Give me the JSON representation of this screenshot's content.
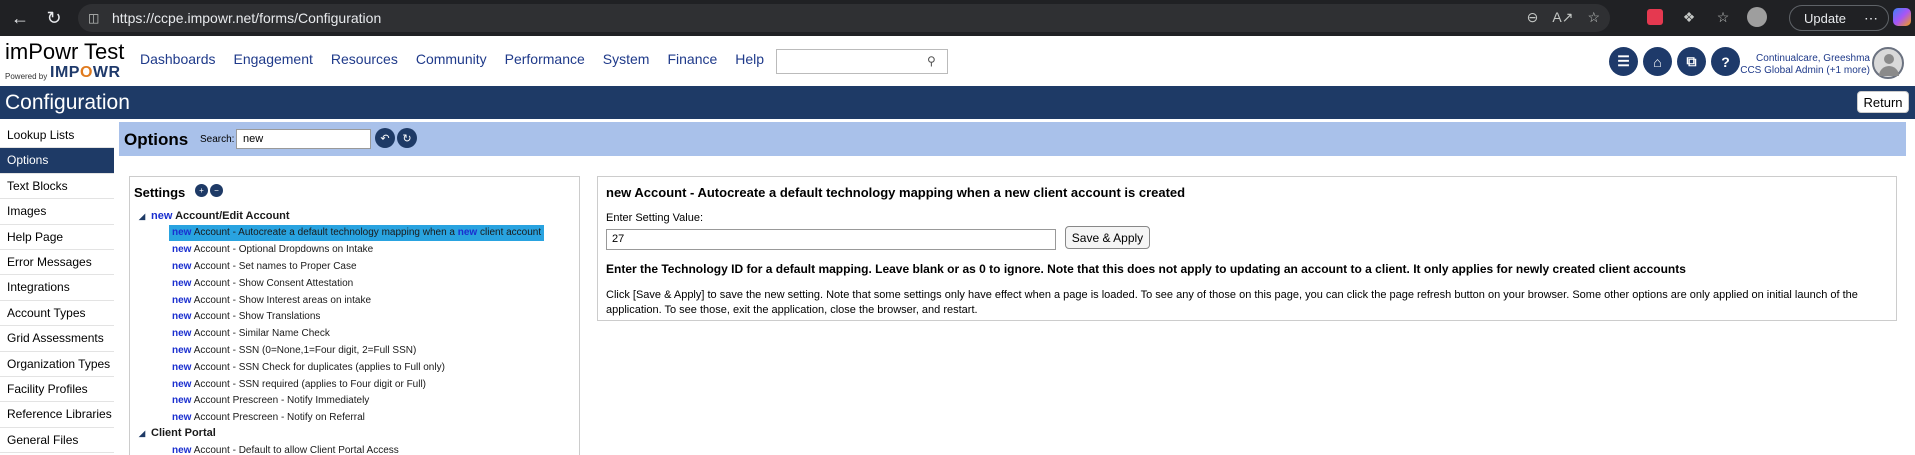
{
  "browser": {
    "url": "https://ccpe.impowr.net/forms/Configuration",
    "update_label": "Update"
  },
  "brand": {
    "title": "imPowr Test",
    "powered_by": "Powered by",
    "logo_pre": "IMP",
    "logo_o": "O",
    "logo_post": "WR"
  },
  "nav": {
    "items": [
      "Dashboards",
      "Engagement",
      "Resources",
      "Community",
      "Performance",
      "System",
      "Finance",
      "Help"
    ]
  },
  "user": {
    "name": "Continualcare, Greeshma",
    "role": "CCS Global Admin (+1 more)"
  },
  "page": {
    "title": "Configuration",
    "return_label": "Return"
  },
  "sidebar": {
    "items": [
      "Lookup Lists",
      "Options",
      "Text Blocks",
      "Images",
      "Help Page",
      "Error Messages",
      "Integrations",
      "Account Types",
      "Grid Assessments",
      "Organization Types",
      "Facility Profiles",
      "Reference Libraries",
      "General Files"
    ],
    "active_index": 1
  },
  "options": {
    "title": "Options",
    "search_label": "Search:",
    "search_value": "new"
  },
  "settings": {
    "title": "Settings",
    "keyword": "new",
    "groups": [
      {
        "label": "Account/Edit Account",
        "items": [
          "Account - Autocreate a default technology mapping when a",
          "Account - Optional Dropdowns on Intake",
          "Account - Set names to Proper Case",
          "Account - Show Consent Attestation",
          "Account - Show Interest areas on intake",
          "Account - Show Translations",
          "Account - Similar Name Check",
          "Account - SSN (0=None,1=Four digit, 2=Full SSN)",
          "Account - SSN Check for duplicates (applies to Full only)",
          "Account - SSN required (applies to Four digit or Full)",
          "Account Prescreen - Notify Immediately",
          "Account Prescreen - Notify on Referral"
        ],
        "first_item_tail": "client account"
      },
      {
        "label": "Client Portal",
        "items": [
          "Account - Default to allow Client Portal Access"
        ]
      }
    ]
  },
  "detail": {
    "title": "new Account - Autocreate a default technology mapping when a new client account is created",
    "label": "Enter Setting Value:",
    "value": "27",
    "apply_label": "Save & Apply",
    "description": "Enter the Technology ID for a default mapping. Leave blank or as 0 to ignore. Note that this does not apply to updating an account to a client. It only applies for newly created client accounts",
    "note": "Click [Save & Apply] to save the new setting. Note that some settings only have effect when a page is loaded. To see any of those on this page, you can click the page refresh button on your browser. Some other options are only applied on initial launch of the application. To see those, exit the application, close the browser, and restart."
  }
}
